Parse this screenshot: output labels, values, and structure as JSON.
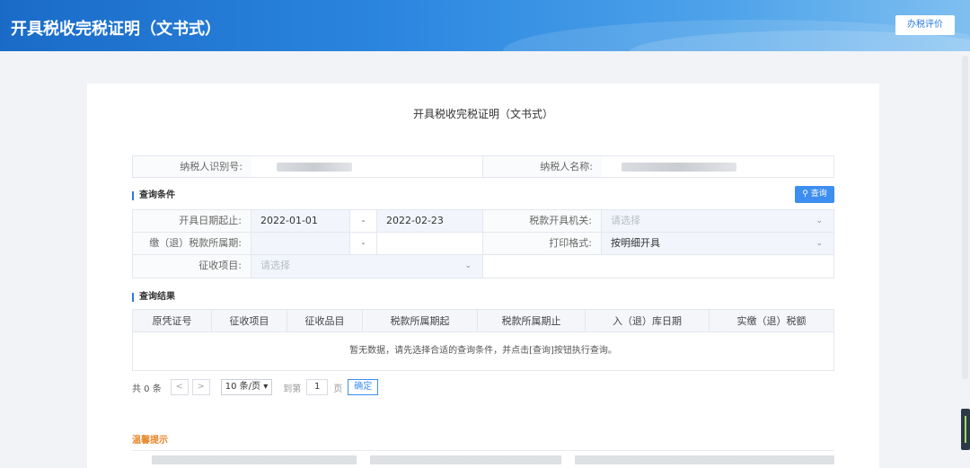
{
  "header": {
    "title": "开具税收完税证明（文书式）",
    "eval_button": "办税评价"
  },
  "page_title": "开具税收完税证明（文书式）",
  "taxpayer": {
    "id_label": "纳税人识别号:",
    "name_label": "纳税人名称:"
  },
  "query": {
    "section_title": "查询条件",
    "search_button": "查询",
    "issue_date_label": "开具日期起止:",
    "issue_date_from": "2022-01-01",
    "date_separator": "-",
    "issue_date_to": "2022-02-23",
    "tax_office_label": "税款开具机关:",
    "tax_office_placeholder": "请选择",
    "period_label": "缴（退）税款所属期:",
    "period_separator": "-",
    "print_format_label": "打印格式:",
    "print_format_value": "按明细开具",
    "levy_item_label": "征收项目:",
    "levy_item_placeholder": "请选择"
  },
  "results": {
    "section_title": "查询结果",
    "columns": [
      "原凭证号",
      "征收项目",
      "征收品目",
      "税款所属期起",
      "税款所属期止",
      "入（退）库日期",
      "实缴（退）税额"
    ],
    "empty_text": "暂无数据，请先选择合适的查询条件，并点击[查询]按钮执行查询。"
  },
  "pagination": {
    "total": "共 0 条",
    "prev": "<",
    "next": ">",
    "page_size": "10 条/页",
    "goto_label": "到第",
    "page_number": "1",
    "page_unit": "页",
    "confirm": "确定"
  },
  "tips": {
    "title": "温馨提示"
  },
  "colors": {
    "accent": "#3d8ef0",
    "tips": "#e8862b"
  }
}
